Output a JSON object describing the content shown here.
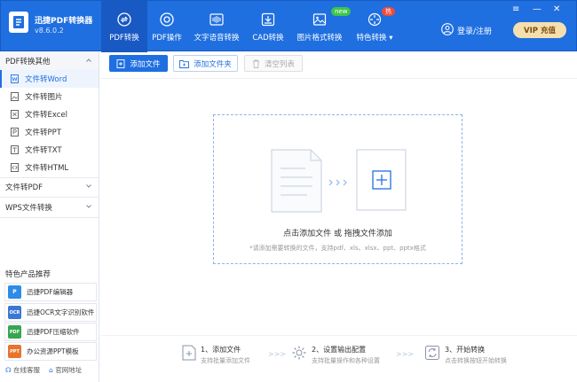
{
  "app": {
    "name": "迅捷PDF转换器",
    "version": "v8.6.0.2"
  },
  "nav": {
    "tabs": [
      {
        "label": "PDF转换",
        "icon": "convert-icon",
        "active": true
      },
      {
        "label": "PDF操作",
        "icon": "target-icon"
      },
      {
        "label": "文字语音转换",
        "icon": "audio-icon"
      },
      {
        "label": "CAD转换",
        "icon": "cad-icon"
      },
      {
        "label": "图片格式转换",
        "icon": "image-icon",
        "badge": "new"
      },
      {
        "label": "特色转换 ▾",
        "icon": "special-icon",
        "badge": "热"
      }
    ]
  },
  "header": {
    "login": "登录/注册",
    "vip": "VIP 充值"
  },
  "sidebar": {
    "sec1": "PDF转换其他",
    "items": [
      "文件转Word",
      "文件转图片",
      "文件转Excel",
      "文件转PPT",
      "文件转TXT",
      "文件转HTML"
    ],
    "sec2": "文件转PDF",
    "sec3": "WPS文件转换",
    "rec_title": "特色产品推荐",
    "rec": [
      "迅捷PDF编辑器",
      "迅捷OCR文字识别软件",
      "迅捷PDF压缩软件",
      "办公资源PPT模板"
    ],
    "rec_colors": [
      "#2f8be8",
      "#3a78d6",
      "#36a64f",
      "#e8732c"
    ],
    "rec_icon_text": [
      "P",
      "OCR",
      "PDF",
      "PPT"
    ],
    "footer": [
      "在线客服",
      "官网地址"
    ]
  },
  "toolbar": {
    "add_file": "添加文件",
    "add_folder": "添加文件夹",
    "clear": "清空列表"
  },
  "drop": {
    "main": "点击添加文件 或 拖拽文件添加",
    "sub": "*请添加需要转换的文件，支持pdf、xls、xlsx、ppt、pptx格式"
  },
  "steps": [
    {
      "title": "1、添加文件",
      "sub": "支持批量添加文件"
    },
    {
      "title": "2、设置输出配置",
      "sub": "支持批量操作和各种设置"
    },
    {
      "title": "3、开始转换",
      "sub": "点击转换按钮开始转换"
    }
  ],
  "colors": {
    "primary": "#1f6fe0",
    "vip_bg": "#f6dfae"
  }
}
